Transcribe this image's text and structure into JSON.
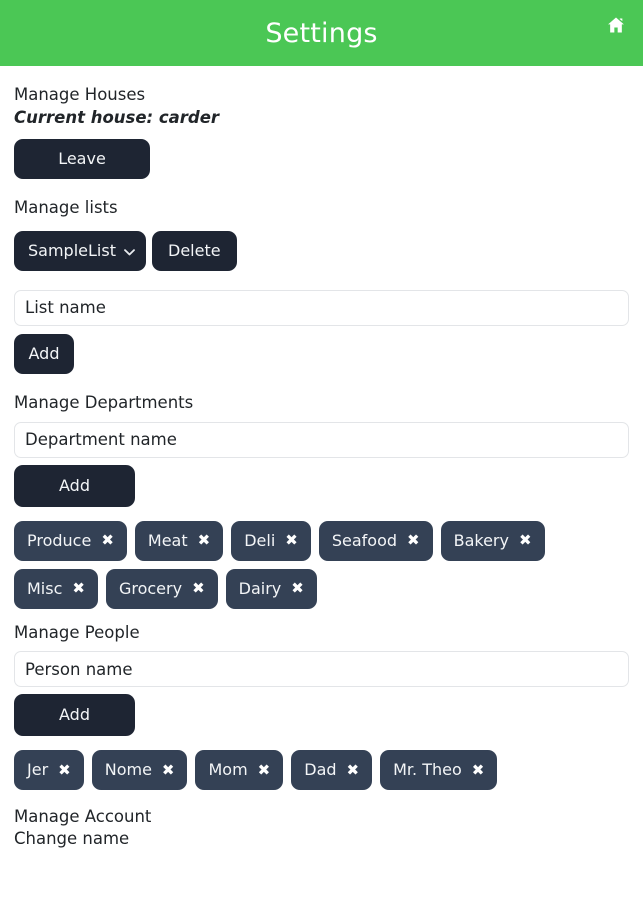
{
  "header": {
    "title": "Settings",
    "home_icon": "home-icon",
    "background_color": "#4bc755",
    "title_color": "#ffffff"
  },
  "theme": {
    "accent": "#4bc755",
    "button_dark": "#1e2533",
    "chip_dark": "#344155",
    "text": "#212529",
    "input_border": "#e3e5e8"
  },
  "houses": {
    "heading": "Manage Houses",
    "current_house": "Current house: carder",
    "leave_label": "Leave"
  },
  "lists": {
    "heading": "Manage lists",
    "selected": "SampleList",
    "options": [
      "SampleList"
    ],
    "chevron_icon": "chevron-down-icon",
    "delete_label": "Delete",
    "input_value": "List name",
    "input_placeholder": "List name",
    "add_label": "Add"
  },
  "departments": {
    "heading": "Manage Departments",
    "input_value": "Department name",
    "input_placeholder": "Department name",
    "add_label": "Add",
    "remove_icon": "close-icon",
    "remove_glyph": "✖",
    "items": [
      "Produce",
      "Meat",
      "Deli",
      "Seafood",
      "Bakery",
      "Misc",
      "Grocery",
      "Dairy"
    ]
  },
  "people": {
    "heading": "Manage People",
    "input_value": "Person name",
    "input_placeholder": "Person name",
    "add_label": "Add",
    "remove_icon": "close-icon",
    "remove_glyph": "✖",
    "items": [
      "Jer",
      "Nome",
      "Mom",
      "Dad",
      "Mr. Theo"
    ]
  },
  "account": {
    "heading": "Manage Account",
    "change_name_label": "Change name"
  }
}
